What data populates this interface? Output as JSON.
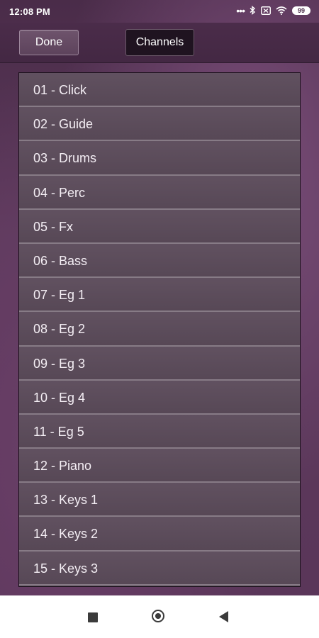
{
  "status_bar": {
    "time": "12:08 PM",
    "battery": "99",
    "icons": [
      "dots-icon",
      "bluetooth-icon",
      "sim-icon",
      "wifi-icon",
      "battery-icon"
    ]
  },
  "toolbar": {
    "done_label": "Done",
    "channels_label": "Channels"
  },
  "channels": [
    {
      "label": "01 - Click"
    },
    {
      "label": "02 - Guide"
    },
    {
      "label": "03 - Drums"
    },
    {
      "label": "04 - Perc"
    },
    {
      "label": "05 - Fx"
    },
    {
      "label": "06 - Bass"
    },
    {
      "label": "07 - Eg 1"
    },
    {
      "label": "08 - Eg 2"
    },
    {
      "label": "09 - Eg 3"
    },
    {
      "label": "10 - Eg 4"
    },
    {
      "label": "11 - Eg 5"
    },
    {
      "label": "12 - Piano"
    },
    {
      "label": "13 - Keys 1"
    },
    {
      "label": "14 - Keys 2"
    },
    {
      "label": "15 - Keys 3"
    }
  ],
  "nav_bar": {
    "buttons": [
      "recents-icon",
      "home-icon",
      "back-icon"
    ]
  },
  "colors": {
    "background": "#5d3a5c",
    "list_item": "#5a4b59",
    "nav_bar": "#ffffff"
  }
}
